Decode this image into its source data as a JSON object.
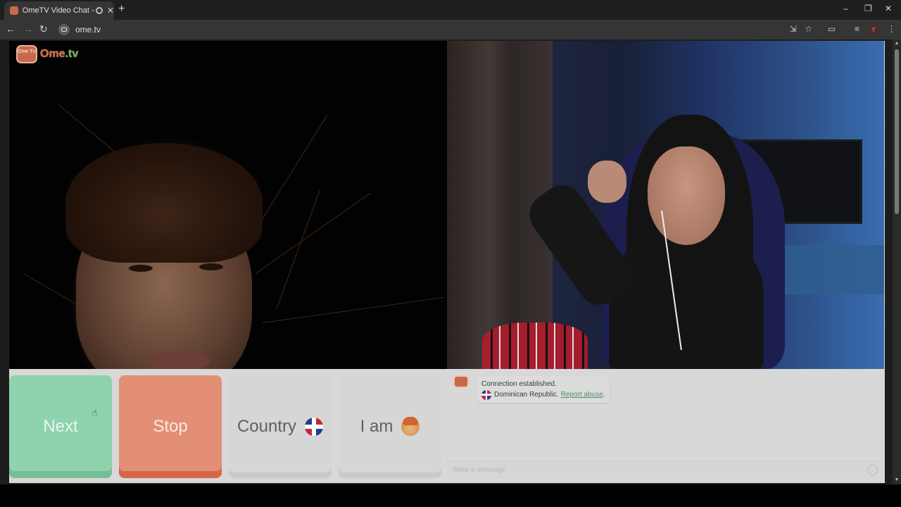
{
  "browser": {
    "tab_title": "OmeTV Video Chat — Ome",
    "new_tab": "+",
    "url": "ome.tv",
    "win_min": "–",
    "win_restore": "❐",
    "win_close": "✕",
    "profile": "Y"
  },
  "logo": {
    "badge": "Ome TV",
    "name": "Ome",
    "sep": ".",
    "tld": "tv"
  },
  "controls": {
    "next": "Next",
    "stop": "Stop",
    "country": "Country",
    "iam": "I am"
  },
  "chat": {
    "line1": "Connection established.",
    "country": "Dominican Republic.",
    "report": "Report abuse",
    "trail": ".",
    "placeholder": "Write a message"
  },
  "colors": {
    "next": "#8fd2ae",
    "stop": "#e38f76",
    "brand": "#d8683e"
  }
}
